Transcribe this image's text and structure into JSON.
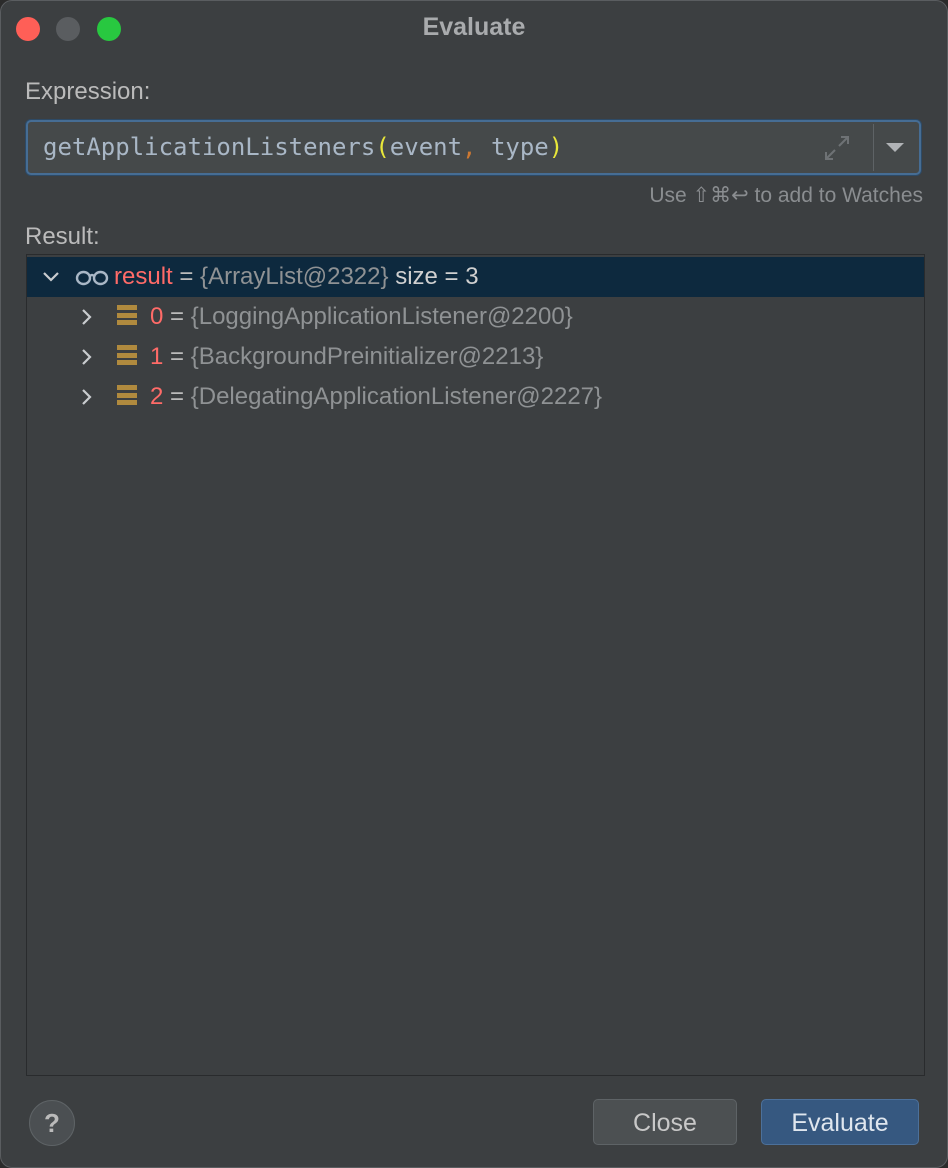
{
  "window": {
    "title": "Evaluate"
  },
  "expression": {
    "label": "Expression:",
    "tokens": {
      "func": "getApplicationListeners",
      "open_paren": "(",
      "arg1": "event",
      "comma": ",",
      "arg2": " type",
      "close_paren": ")"
    },
    "hint": "Use ⇧⌘↩ to add to Watches"
  },
  "result": {
    "label": "Result:",
    "root": {
      "name": "result",
      "eq": " = ",
      "value": "{ArrayList@2322}",
      "size": "  size = 3"
    },
    "items": [
      {
        "index": "0",
        "eq": " = ",
        "value": "{LoggingApplicationListener@2200}"
      },
      {
        "index": "1",
        "eq": " = ",
        "value": "{BackgroundPreinitializer@2213}"
      },
      {
        "index": "2",
        "eq": " = ",
        "value": "{DelegatingApplicationListener@2227}"
      }
    ]
  },
  "buttons": {
    "help": "?",
    "close": "Close",
    "evaluate": "Evaluate"
  },
  "colors": {
    "accent": "#365880",
    "name": "#ff6b68",
    "selection": "#0d293e",
    "field_icon": "#b08a3e"
  }
}
